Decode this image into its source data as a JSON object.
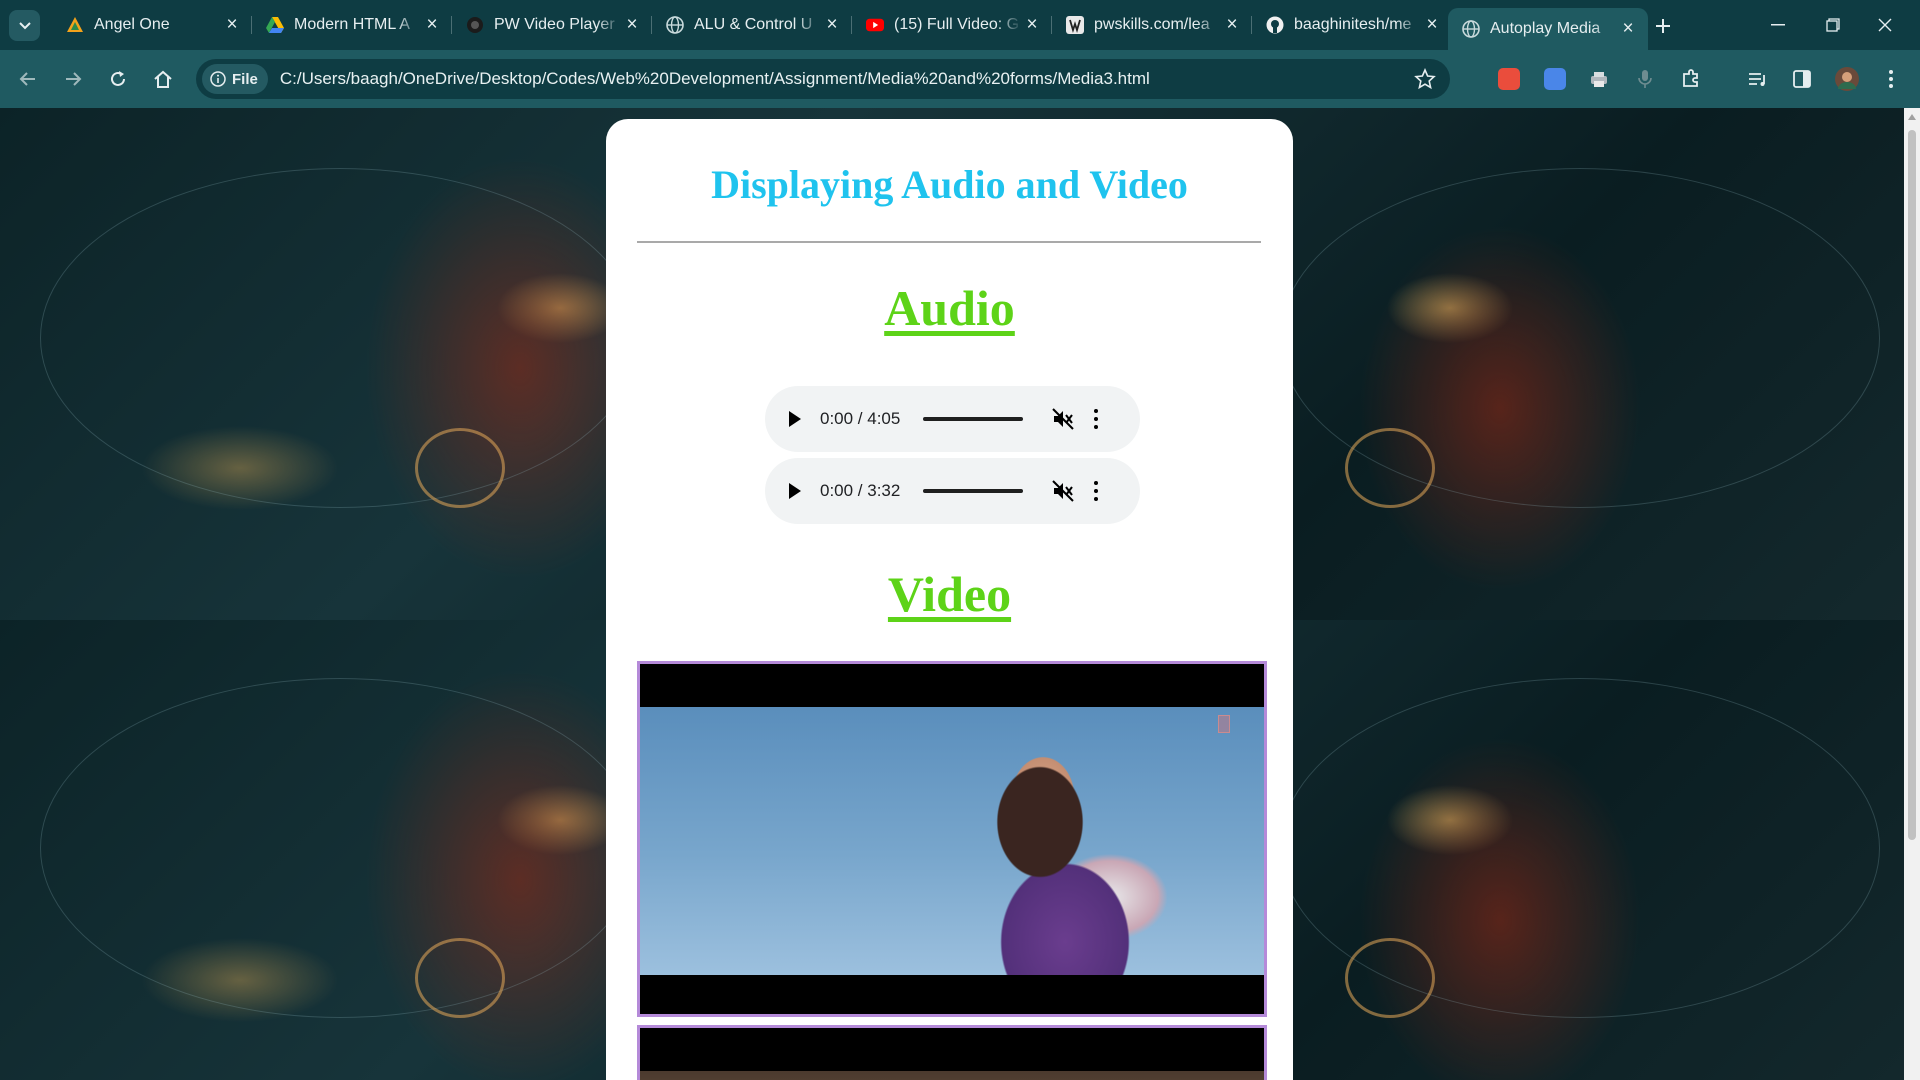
{
  "browser": {
    "tabs": [
      {
        "title": "Angel One",
        "icon": "angel-one-icon",
        "active": false
      },
      {
        "title": "Modern HTML A",
        "icon": "google-drive-icon",
        "active": false
      },
      {
        "title": "PW Video Player",
        "icon": "pw-icon",
        "active": false
      },
      {
        "title": "ALU & Control U",
        "icon": "globe-icon",
        "active": false
      },
      {
        "title": "(15) Full Video: G",
        "icon": "youtube-icon",
        "active": false
      },
      {
        "title": "pwskills.com/lea",
        "icon": "pwskills-icon",
        "active": false
      },
      {
        "title": "baaghinitesh/me",
        "icon": "github-icon",
        "active": false
      },
      {
        "title": "Autoplay Media",
        "icon": "globe-icon",
        "active": true
      }
    ],
    "address_chip": "File",
    "url": "C:/Users/baagh/OneDrive/Desktop/Codes/Web%20Development/Assignment/Media%20and%20forms/Media3.html"
  },
  "page": {
    "title": "Displaying Audio and Video",
    "audio_heading": "Audio",
    "video_heading": "Video",
    "audio_players": [
      {
        "time": "0:00 / 4:05",
        "muted": true
      },
      {
        "time": "0:00 / 3:32",
        "muted": true
      }
    ]
  },
  "colors": {
    "title": "#1fc3ee",
    "section_heading": "#5dd318",
    "video_border": "#b58ad9",
    "browser_frame": "#0e3c43",
    "toolbar": "#1f5a61"
  }
}
